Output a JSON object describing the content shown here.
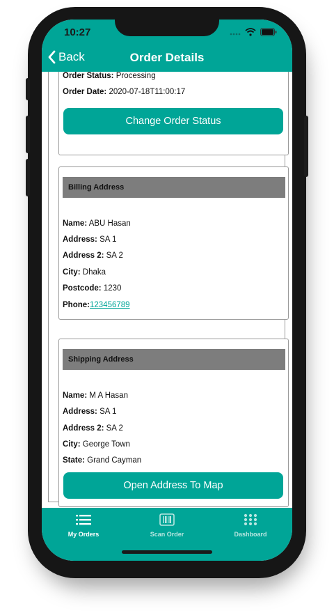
{
  "status_bar": {
    "time": "10:27"
  },
  "nav": {
    "back_label": "Back",
    "title": "Order Details"
  },
  "order": {
    "status_label": "Order Status:",
    "status_value": "Processing",
    "date_label": "Order Date:",
    "date_value": "2020-07-18T11:00:17",
    "change_status_button": "Change Order Status"
  },
  "billing": {
    "header": "Billing Address",
    "name_label": "Name:",
    "name_value": "ABU Hasan",
    "address_label": "Address:",
    "address_value": "SA 1",
    "address2_label": "Address 2:",
    "address2_value": "SA 2",
    "city_label": "City:",
    "city_value": "Dhaka",
    "postcode_label": "Postcode:",
    "postcode_value": "1230",
    "phone_label": "Phone:",
    "phone_value": "123456789"
  },
  "shipping": {
    "header": "Shipping Address",
    "name_label": "Name:",
    "name_value": "M A Hasan",
    "address_label": "Address:",
    "address_value": "SA 1",
    "address2_label": "Address 2:",
    "address2_value": "SA 2",
    "city_label": "City:",
    "city_value": "George Town",
    "state_label": "State:",
    "state_value": "Grand Cayman",
    "map_button": "Open Address To Map"
  },
  "tabs": [
    {
      "label": "My Orders",
      "icon": "list-icon",
      "active": true
    },
    {
      "label": "Scan Order",
      "icon": "barcode-icon",
      "active": false
    },
    {
      "label": "Dashboard",
      "icon": "grid-icon",
      "active": false
    }
  ],
  "colors": {
    "accent": "#00a597",
    "header_bar": "#7d7d7d",
    "inactive_tab": "#b9e6e1"
  }
}
